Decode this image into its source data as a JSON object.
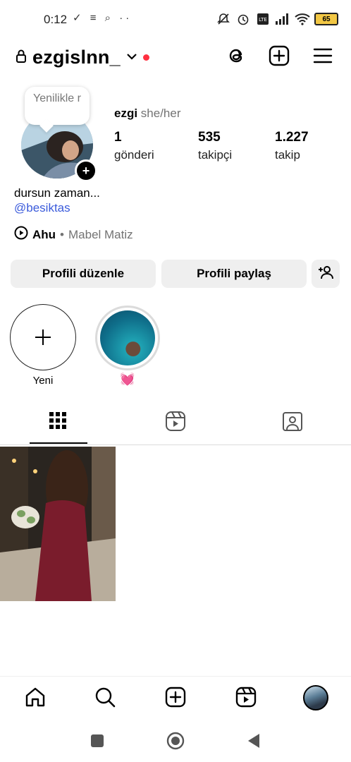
{
  "status": {
    "time": "0:12",
    "left_icons": "✓ ≡ ⌕ ··",
    "battery": "65"
  },
  "header": {
    "username": "ezgislnn_",
    "icons": [
      "lock-icon",
      "chevron-down-icon",
      "threads-icon",
      "add-post-icon",
      "menu-icon"
    ]
  },
  "tooltip": {
    "text": "Yenilikle r"
  },
  "profile": {
    "name": "ezgi",
    "pronouns": "she/her",
    "stats": [
      {
        "value": "1",
        "label": "gönderi"
      },
      {
        "value": "535",
        "label": "takipçi"
      },
      {
        "value": "1.227",
        "label": "takip"
      }
    ],
    "bio": "dursun zaman...",
    "link": "@besiktas",
    "music": {
      "title": "Ahu",
      "separator": "•",
      "artist": "Mabel Matiz"
    }
  },
  "buttons": {
    "edit": "Profili düzenle",
    "share": "Profili paylaş"
  },
  "highlights": [
    {
      "label": "Yeni"
    },
    {
      "label": "💓"
    }
  ],
  "tabs": [
    "grid-icon",
    "reels-icon",
    "tagged-icon"
  ],
  "bottom_nav": [
    "home-icon",
    "search-icon",
    "create-icon",
    "reels-icon",
    "profile-avatar"
  ],
  "colors": {
    "accent": "#3b5bdb",
    "dot": "#ff3040",
    "button_bg": "#efefef"
  }
}
